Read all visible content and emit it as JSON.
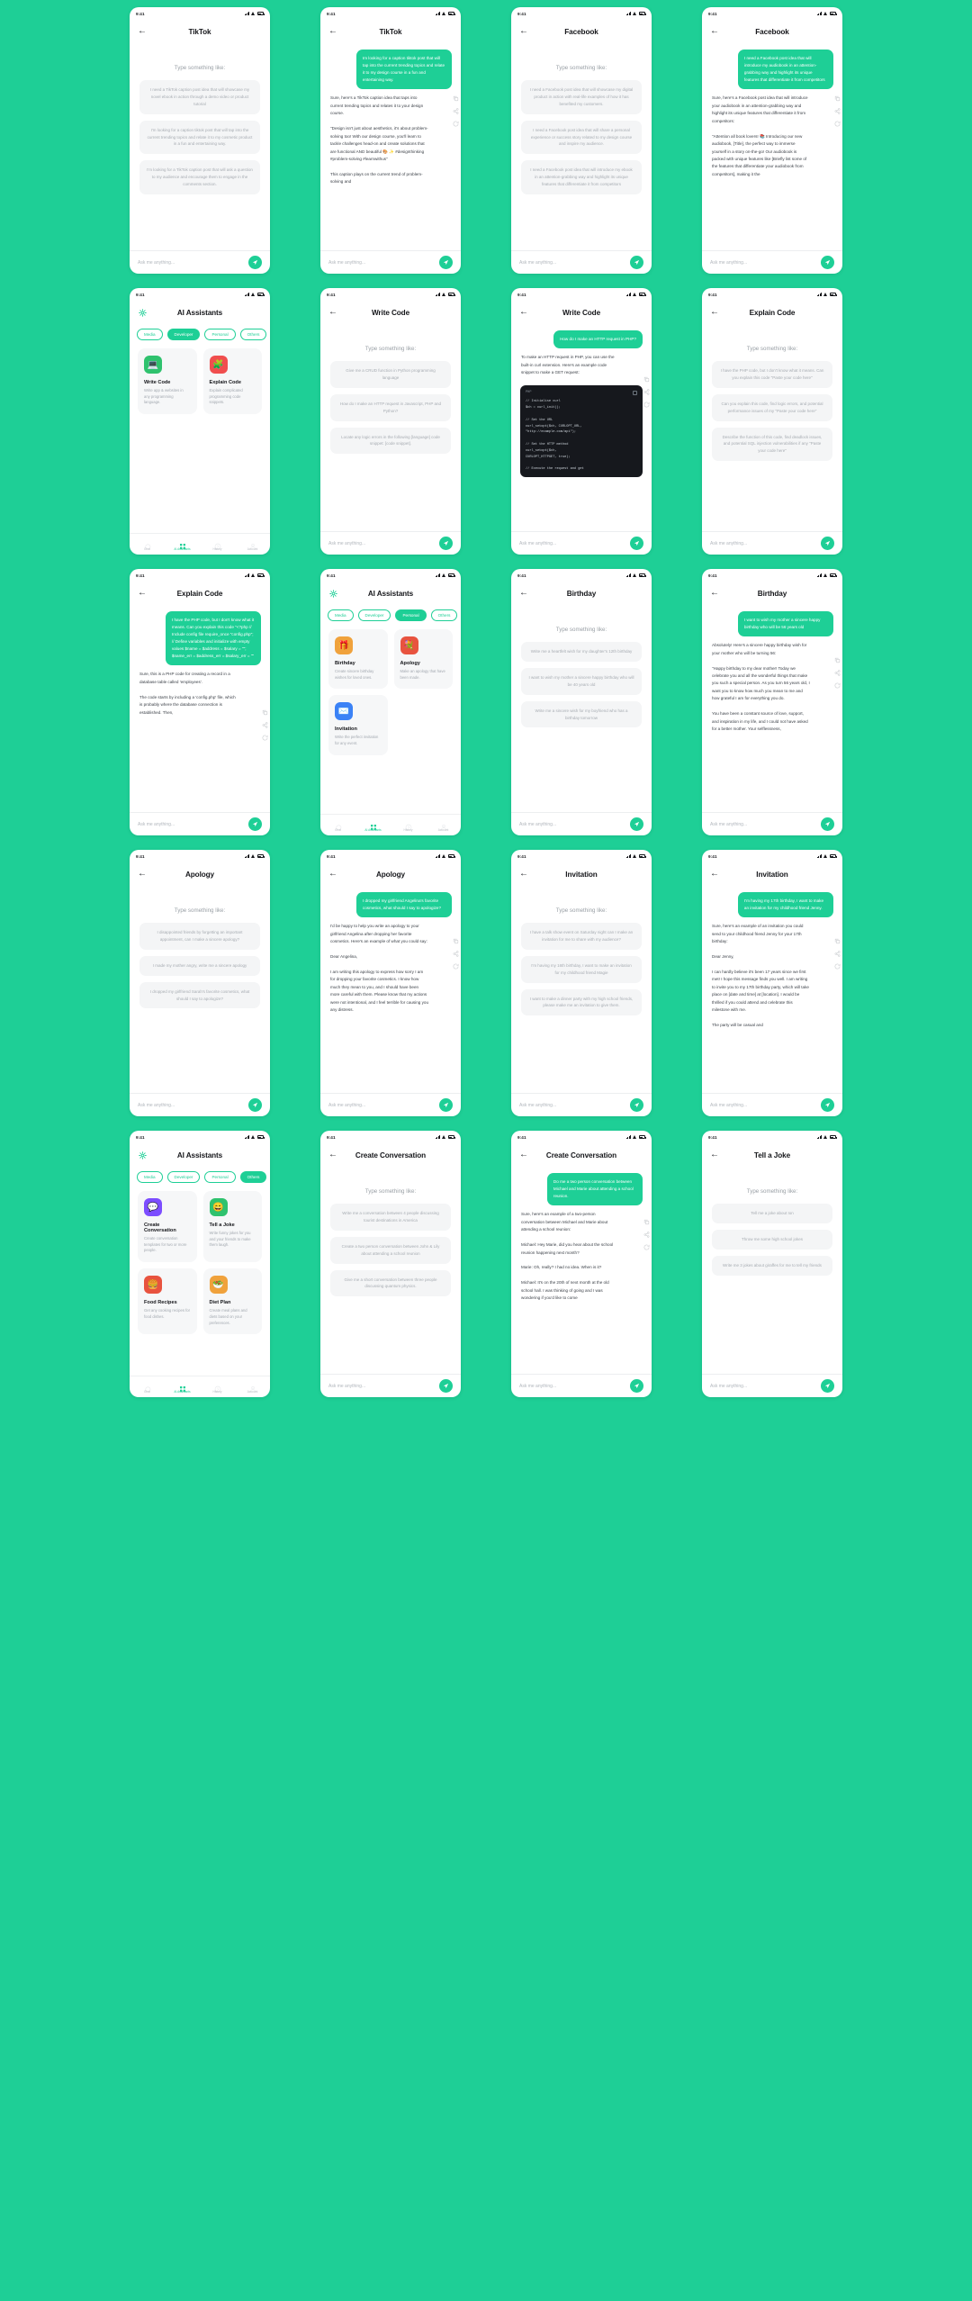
{
  "meta": {
    "status_time": "9:41",
    "brand_color": "#1ECF96",
    "composer_placeholder": "Ask me anything...",
    "prompt_hint": "Type something like:",
    "back_icon": "arrow-left-icon",
    "send_icon": "send-icon",
    "logo_icon": "sparkle-logo-icon"
  },
  "bottom_nav": {
    "items": [
      {
        "label": "Chat",
        "icon": "chat-icon"
      },
      {
        "label": "AI Assistants",
        "icon": "grid-icon"
      },
      {
        "label": "History",
        "icon": "clock-icon"
      },
      {
        "label": "Account",
        "icon": "person-icon"
      }
    ]
  },
  "chip_tabs": [
    "Media",
    "Developer",
    "Personal",
    "Others"
  ],
  "screens": [
    {
      "id": "tiktok-suggestions",
      "title": "TikTok",
      "type": "suggestions",
      "suggestions": [
        "I need a TikTok caption post idea that will showcase my novel ebook in action through a demo video or product tutorial",
        "I'm looking for a caption tiktok post that will tap into the current trending topics and relate it to my cosmetic product in a fun and entertaining way.",
        "I'm looking for a TikTok caption post that will ask a question to my audience and encourage them to engage in the comments section."
      ]
    },
    {
      "id": "tiktok-chat",
      "title": "TikTok",
      "type": "chat",
      "user": "Im looking for a caption tiktok post that will tap into the current trending topics and relate it to my design course in a fun and entertaining way.",
      "ai": "Sure, here's a TikTok caption idea that taps into current trending topics and relates it to your design course.\n\n\"Design isn't just about aesthetics, it's about problem-solving too! With our design course, you'll learn to tackle challenges head-on and create solutions that are functional AND beautiful 🎨 ✨ #designthinking #problem-solving #learnwithus\"\n\nThis caption plays on the current trend of problem-solving and"
    },
    {
      "id": "facebook-suggestions",
      "title": "Facebook",
      "type": "suggestions",
      "suggestions": [
        "I need a Facebook post idea that will showcase my digital product in action with real-life examples of how it has benefited my customers.",
        "I need a Facebook post idea that will share a personal experience or success story related to my design course and inspire my audience.",
        "I need a Facebook post idea that will introduce my ebook in an attention-grabbing way and highlight its unique features that differentiate it from competitors"
      ]
    },
    {
      "id": "facebook-chat",
      "title": "Facebook",
      "type": "chat",
      "user": "I need a Facebook post idea that will introduce my audiobook in an attention-grabbing way and highlight its unique features that differentiate it from competitors",
      "ai": "Sure, here's a Facebook post idea that will introduce your audiobook in an attention-grabbing way and highlight its unique features that differentiate it from competitors:\n\n\"Attention all book lovers! 📚 Introducing our new audiobook, [Title], the perfect way to immerse yourself in a story on-the-go! Our audiobook is packed with unique features like [Briefly list some of the features that differentiate your audiobook from competitors], making it the"
    },
    {
      "id": "assistants-developer",
      "title": "AI Assistants",
      "type": "assistants",
      "active_chip": "Developer",
      "cards": [
        {
          "title": "Write Code",
          "desc": "Write app & websites in any programming language.",
          "icon": "laptop-icon",
          "icon_bg": "#2FC26E",
          "glyph": "💻"
        },
        {
          "title": "Explain Code",
          "desc": "Explain complicated programming code snippets.",
          "icon": "code-icon",
          "icon_bg": "#F04E4E",
          "glyph": "🧩"
        }
      ]
    },
    {
      "id": "write-code-suggestions",
      "title": "Write Code",
      "type": "suggestions",
      "suggestions": [
        "Give me a CRUD function in Python programming language",
        "How do I make an HTTP request in Javascript, PHP and Python?",
        "Locate any logic errors in the following [language] code snippet: [code snippet]."
      ]
    },
    {
      "id": "write-code-chat",
      "title": "Write Code",
      "type": "code-chat",
      "user": "How do I make an HTTP request in PHP?",
      "ai": "To make an HTTP request in PHP, you can use the built-in curl extension. Here's an example code snippet to make a GET request:",
      "code_lang": "PHP",
      "code": "// Initialise curl\n$ch = curl_init();\n\n// Set the URL\ncurl_setopt($ch, CURLOPT_URL,\n\"http://example.com/api\");\n\n// Set the HTTP method\ncurl_setopt($ch,\nCURLOPT_HTTPGET, true);\n\n// Execute the request and get"
    },
    {
      "id": "explain-code-suggestions",
      "title": "Explain Code",
      "type": "suggestions",
      "suggestions": [
        "I have the PHP code, but I don't know what it means. Can you explain this code \"Paste your code here\"",
        "Can you explain this code, find logic errors, and potential performance issues of my \"Paste your code here\"",
        "Describe the function of this code, find deadlock issues, and potential SQL injection vulnerabilities if any \"Paste your code here\""
      ]
    },
    {
      "id": "explain-code-chat",
      "title": "Explain Code",
      "type": "code-user-chat",
      "user": "I have the PHP code, but I don't know what it means. Can you explain this code\n\"<?php\n// Include config file\nrequire_once \"config.php\";\n\n// Define variables and initialize with empty values\n$name = $address = $salary = \"\";\n$name_err = $address_err =\n$salary_err = \"\"",
      "ai": "Sure, this is a PHP code for creating a record in a database table called 'employees'.\n\nThe code starts by including a 'config.php' file, which is probably where the database connection is established. Then,"
    },
    {
      "id": "assistants-personal",
      "title": "AI Assistants",
      "type": "assistants",
      "active_chip": "Personal",
      "cards": [
        {
          "title": "Birthday",
          "desc": "Create sincere birthday wishes for loved ones.",
          "icon": "gift-icon",
          "icon_bg": "#F0A23C",
          "glyph": "🎁"
        },
        {
          "title": "Apology",
          "desc": "Make an apology that have been made.",
          "icon": "heart-icon",
          "icon_bg": "#E8533F",
          "glyph": "💐"
        },
        {
          "title": "Invitation",
          "desc": "Write the perfect invitation for any event.",
          "icon": "envelope-icon",
          "icon_bg": "#3B82F6",
          "glyph": "✉️"
        }
      ]
    },
    {
      "id": "birthday-suggestions",
      "title": "Birthday",
      "type": "suggestions",
      "suggestions": [
        "Write me a heartfelt wish for my daughter's 12th birthday",
        "I want to wish my mother a sincere happy birthday who will be 40 years old",
        "Write me a sincere wish for my boyfriend who has a birthday tomorrow"
      ]
    },
    {
      "id": "birthday-chat",
      "title": "Birthday",
      "type": "chat",
      "user": "I want to wish my mother a sincere happy birthday who will be 56 years old",
      "ai": "Absolutely! Here's a sincere happy birthday wish for your mother who will be turning 56:\n\n\"Happy birthday to my dear mother! Today we celebrate you and all the wonderful things that make you such a special person. As you turn 56 years old, I want you to know how much you mean to me and how grateful I am for everything you do.\n\nYou have been a constant source of love, support, and inspiration in my life, and I could not have asked for a better mother. Your selflessness,"
    },
    {
      "id": "apology-suggestions",
      "title": "Apology",
      "type": "suggestions",
      "suggestions": [
        "I disappointed friends by forgetting an important appointment, can I make a sincere apology?",
        "I made my mother angry, write me a sincere apology",
        "I dropped my girlfriend Sarah's favorite cosmetics, what should I say to apologize?"
      ]
    },
    {
      "id": "apology-chat",
      "title": "Apology",
      "type": "chat",
      "user": "I dropped my girlfriend Angelina's favorite cosmetics, what should I say to apologize?",
      "ai": "I'd be happy to help you write an apology to your girlfriend Angelina after dropping her favorite cosmetics. Here's an example of what you could say:\n\nDear Angelina,\n\nI am writing this apology to express how sorry I am for dropping your favorite cosmetics. I know how much they mean to you, and I should have been more careful with them. Please know that my actions were not intentional, and I feel terrible for causing you any distress."
    },
    {
      "id": "invitation-suggestions",
      "title": "Invitation",
      "type": "suggestions",
      "suggestions": [
        "I have a talk show event on Saturday night can I make an invitation for me to share with my audience?",
        "I'm having my 16th birthday, I want to make an invitation for my childhood friend Magie",
        "I want to make a dinner party with my high school friends, please make me an invitation to give them."
      ]
    },
    {
      "id": "invitation-chat",
      "title": "Invitation",
      "type": "chat",
      "user": "I'm having my 17th birthday, I want to make an invitation for my childhood friend Jenny.",
      "ai": "Sure, here's an example of an invitation you could send to your childhood friend Jenny for your 17th birthday:\n\nDear Jenny,\n\nI can hardly believe it's been 17 years since we first met! I hope this message finds you well. I am writing to invite you to my 17th birthday party, which will take place on [date and time] at [location]. I would be thrilled if you could attend and celebrate this milestone with me.\n\nThe party will be casual and"
    },
    {
      "id": "assistants-others",
      "title": "AI Assistants",
      "type": "assistants",
      "active_chip": "Others",
      "cards": [
        {
          "title": "Create Conversation",
          "desc": "Create conversation templates for two or more people.",
          "icon": "chat-bubble-icon",
          "icon_bg": "#7C4DFF",
          "glyph": "💬"
        },
        {
          "title": "Tell a Joke",
          "desc": "Write funny jokes for you and your friends to make them laugh.",
          "icon": "smile-icon",
          "icon_bg": "#2FC26E",
          "glyph": "😄"
        },
        {
          "title": "Food Recipes",
          "desc": "Get any cooking recipes for food dishes.",
          "icon": "food-icon",
          "icon_bg": "#E8533F",
          "glyph": "🍔"
        },
        {
          "title": "Diet Plan",
          "desc": "Create meal plans and diets based on your preferences.",
          "icon": "salad-icon",
          "icon_bg": "#F0A23C",
          "glyph": "🥗"
        }
      ]
    },
    {
      "id": "create-conversation-suggestions",
      "title": "Create Conversation",
      "type": "suggestions",
      "suggestions": [
        "Write me a conversation between 4 people discussing tourist destinations in America",
        "Create a two person conversation between John & Lily about attending a school reunion",
        "Give me a short conversation between three people discussing quantum physics."
      ]
    },
    {
      "id": "create-conversation-chat",
      "title": "Create Conversation",
      "type": "chat",
      "user": "Do me a two person conversation between Michael and Marie about attending a school reunion.",
      "ai": "Sure, here's an example of a two-person conversation between Michael and Marie about attending a school reunion:\n\nMichael: Hey Marie, did you hear about the school reunion happening next month?\n\nMarie: Oh, really? I had no idea. When is it?\n\nMichael: It's on the 20th of next month at the old school hall. I was thinking of going and I was wondering if you'd like to come"
    },
    {
      "id": "tell-a-joke-suggestions",
      "title": "Tell a Joke",
      "type": "suggestions",
      "suggestions": [
        "Tell me a joke about Ion",
        "Throw me some high school jokes",
        "Write me 3 jokes about giraffes for me to tell my friends"
      ]
    }
  ]
}
